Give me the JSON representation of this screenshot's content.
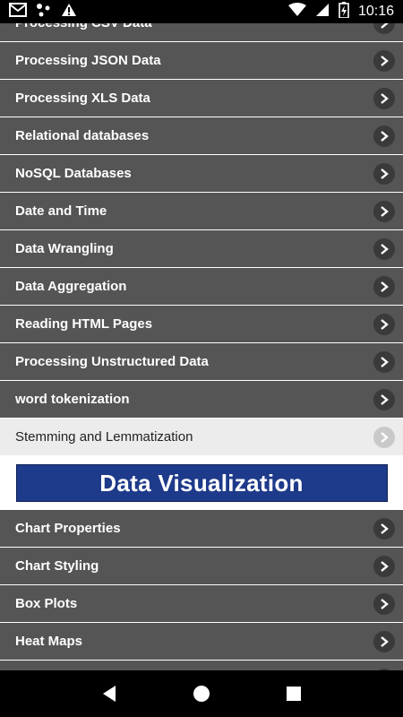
{
  "status_bar": {
    "time": "10:16",
    "icons": [
      "gmail-icon",
      "dots-icon",
      "warning-icon",
      "wifi-icon",
      "signal-icon",
      "battery-icon"
    ]
  },
  "list_top": [
    {
      "label": "Processing CSV Data"
    },
    {
      "label": "Processing JSON Data"
    },
    {
      "label": "Processing XLS Data"
    },
    {
      "label": "Relational databases"
    },
    {
      "label": "NoSQL Databases"
    },
    {
      "label": "Date and Time"
    },
    {
      "label": "Data Wrangling"
    },
    {
      "label": "Data Aggregation"
    },
    {
      "label": "Reading HTML Pages"
    },
    {
      "label": "Processing Unstructured Data"
    },
    {
      "label": "word tokenization"
    }
  ],
  "selected_item": {
    "label": "Stemming and Lemmatization"
  },
  "section_header": {
    "title": "Data Visualization"
  },
  "list_bottom": [
    {
      "label": "Chart Properties"
    },
    {
      "label": "Chart Styling"
    },
    {
      "label": "Box Plots"
    },
    {
      "label": "Heat Maps"
    },
    {
      "label": ""
    }
  ],
  "nav_bar": {
    "buttons": [
      "back",
      "home",
      "recents"
    ]
  },
  "colors": {
    "row_bg": "#555555",
    "selected_bg": "#ececec",
    "banner_bg": "#1e3a8a"
  }
}
